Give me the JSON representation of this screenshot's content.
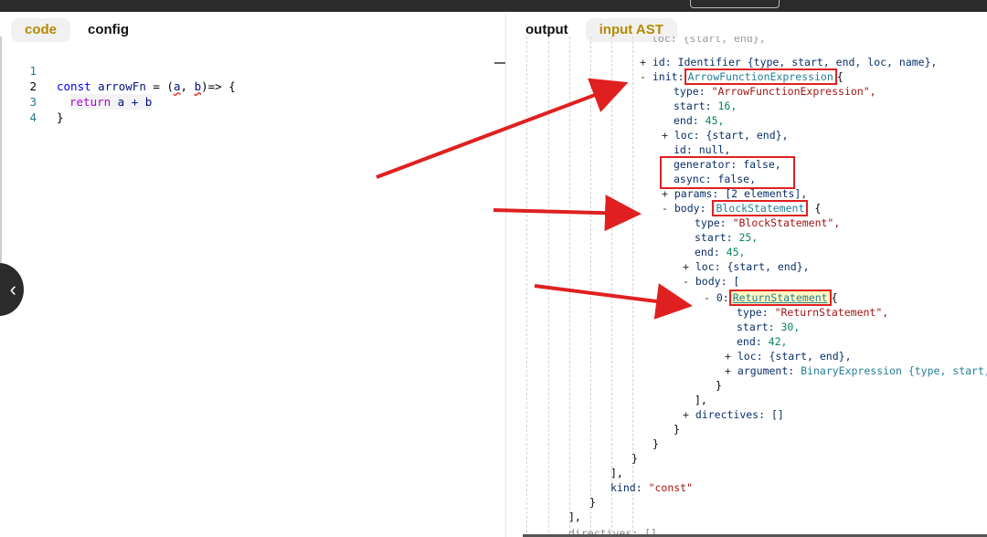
{
  "left_tabs": [
    {
      "label": "code",
      "active": true
    },
    {
      "label": "config",
      "active": false
    }
  ],
  "right_tabs": [
    {
      "label": "output",
      "active": false
    },
    {
      "label": "input AST",
      "active": true
    }
  ],
  "editor": {
    "line_numbers": [
      "1",
      "2",
      "3",
      "4"
    ],
    "current_line": "2",
    "line1": {
      "kw": "const",
      "name": "arrowFn",
      "eq": " = (",
      "a": "a",
      "comma": ", ",
      "b": "b",
      "tail": ")=> {"
    },
    "line2": {
      "kw": "return",
      "expr": " a + b"
    },
    "line3": "}"
  },
  "ast": {
    "top_partial": "loc: {start, end},",
    "id_line": "id: Identifier {type, start, end, loc, name},",
    "init_key": "init:",
    "init_type": "ArrowFunctionExpression",
    "init_open": "{",
    "type_key": "type:",
    "init_type_str": "\"ArrowFunctionExpression\",",
    "start_key": "start:",
    "init_start": "16,",
    "end_key": "end:",
    "init_end": "45,",
    "loc_line": "loc: {start, end},",
    "id_null": "id: null,",
    "generator_key": "generator:",
    "generator_val": "false,",
    "async_key": "async:",
    "async_val": "false,",
    "params_line": "params: [2 elements],",
    "body_key": "body:",
    "body_type": "BlockStatement",
    "body_open": "{",
    "body_type_str": "\"BlockStatement\",",
    "body_start": "25,",
    "body_end": "45,",
    "body2_key": "body: [",
    "item_key": "0:",
    "ret_type": "ReturnStatement",
    "ret_open": "{",
    "ret_type_str": "\"ReturnStatement\",",
    "ret_start": "30,",
    "ret_end": "42,",
    "argument_key": "argument:",
    "argument_val": "BinaryExpression {type, start, end",
    "close_brace": "}",
    "close_arr": "],",
    "directives_line": "directives: []",
    "kind_key": "kind:",
    "kind_val": "\"const\"",
    "close_arr_plain": "],",
    "bottom_partial": "directives: []",
    "plus": "+",
    "minus": "-"
  },
  "colors": {
    "accent": "#b58a00",
    "arrow": "#e02020",
    "box": "#e02020"
  },
  "icons": {
    "collapse": "chevron-left-icon"
  }
}
